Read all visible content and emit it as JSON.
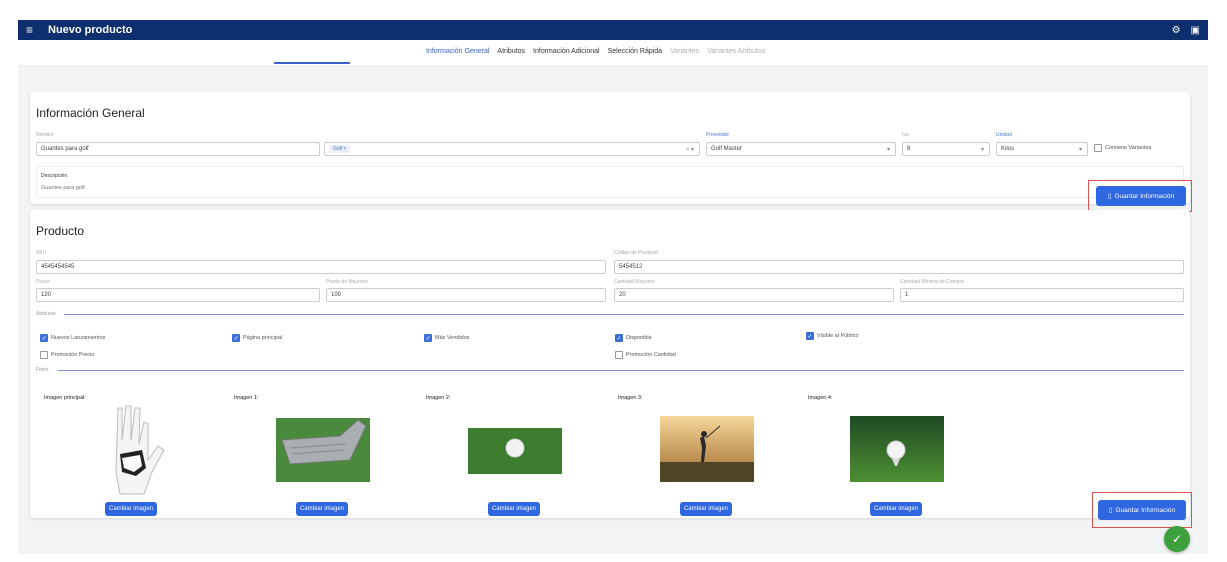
{
  "appbar": {
    "title": "Nuevo producto"
  },
  "tabs": [
    {
      "label": "Información General"
    },
    {
      "label": "Atributos"
    },
    {
      "label": "Información Adicional"
    },
    {
      "label": "Selección Rápida"
    },
    {
      "label": "Variantes"
    },
    {
      "label": "Variantes Atributos"
    }
  ],
  "info": {
    "title": "Información General",
    "nombre_label": "Nombre",
    "nombre_value": "Guantes para golf",
    "tag_chip": "Golf",
    "proveedor_label": "Proveedor",
    "proveedor_value": "Golf Master",
    "iva_label": "Iva",
    "iva_value": "8",
    "unidad_label": "Unidad",
    "unidad_value": "Kilos",
    "variantes_label": "Contiene Variantes",
    "descripcion_label": "Descripción",
    "descripcion_value": "Guantes para golf",
    "save_label": "Guardar Información"
  },
  "producto": {
    "title": "Producto",
    "sku_label": "SKU",
    "sku_value": "4545454545",
    "codigo_label": "Código de Producto",
    "codigo_value": "5454512",
    "precio_label": "Precio",
    "precio_value": "120",
    "precio_mayoreo_label": "Precio de Mayoreo",
    "precio_mayoreo_value": "100",
    "cantidad_mayoreo_label": "Cantidad Mayoreo",
    "cantidad_mayoreo_value": "20",
    "cantidad_minima_label": "Cantidad Mínima de Compra",
    "cantidad_minima_value": "1",
    "atributos_label": "Atributos",
    "checks": {
      "nuevos": "Nuevos Lanzamientos",
      "principal": "Página principal",
      "vendidos": "Más Vendidos",
      "disponible": "Disponible",
      "visible": "Visible al Público",
      "promo_precio": "Promoción Precio",
      "promo_cantidad": "Promoción Cantidad"
    },
    "fotos_label": "Fotos",
    "images": [
      {
        "label": "Imagen principal:"
      },
      {
        "label": "Imagen 1:"
      },
      {
        "label": "Imagen 2:"
      },
      {
        "label": "Imagen 3:"
      },
      {
        "label": "Imagen 4:"
      }
    ],
    "change_label": "Cambiar imagen",
    "save_label": "Guardar Información"
  },
  "colors": {
    "appbar": "#0d2f6e",
    "accent": "#2f67e0",
    "highlight": "#d9534f",
    "success": "#3ca13c"
  }
}
